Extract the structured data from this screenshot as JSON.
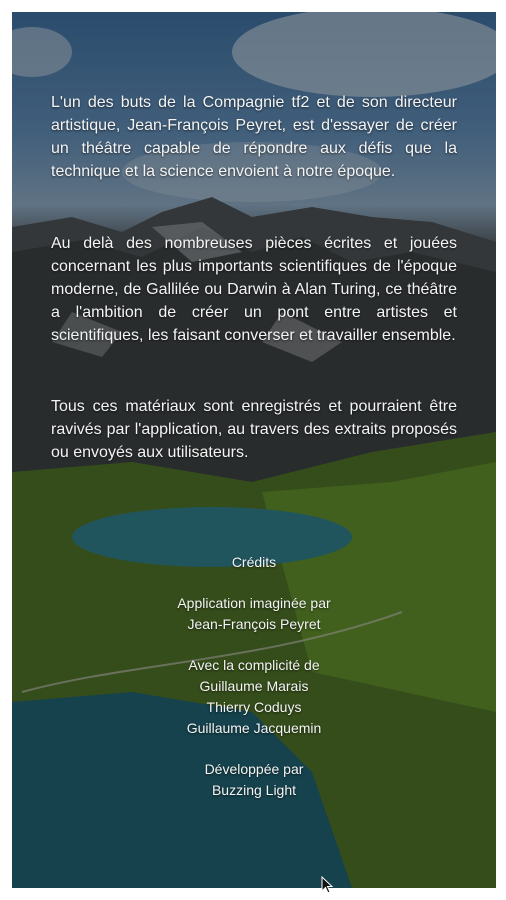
{
  "about": {
    "paragraph_1": "L'un des buts de la Compagnie tf2 et de son directeur artistique, Jean-François Peyret, est d'essayer de créer un théâtre capable de répondre aux défis que la technique et la science envoient à notre époque.",
    "paragraph_2": "Au delà des nombreuses pièces écrites et jouées concernant les plus importants scientifiques de l'époque moderne, de Gallilée ou Darwin à Alan Turing, ce théâtre a l'ambition de créer un pont entre artistes et scientifiques, les faisant converser et travailler ensemble.",
    "paragraph_3": "Tous ces matériaux sont enregistrés et pourraient être ravivés par l'application, au travers des extraits proposés ou envoyés aux utilisateurs."
  },
  "credits": {
    "title": "Crédits",
    "concept_heading": "Application imaginée par",
    "concept_name": "Jean-François Peyret",
    "complicity_heading": "Avec la complicité de",
    "complicity_names": [
      "Guillaume Marais",
      "Thierry Coduys",
      "Guillaume Jacquemin"
    ],
    "developer_heading": "Développée par",
    "developer_name": "Buzzing Light"
  },
  "icons": {
    "cursor": "mouse-pointer-icon"
  }
}
